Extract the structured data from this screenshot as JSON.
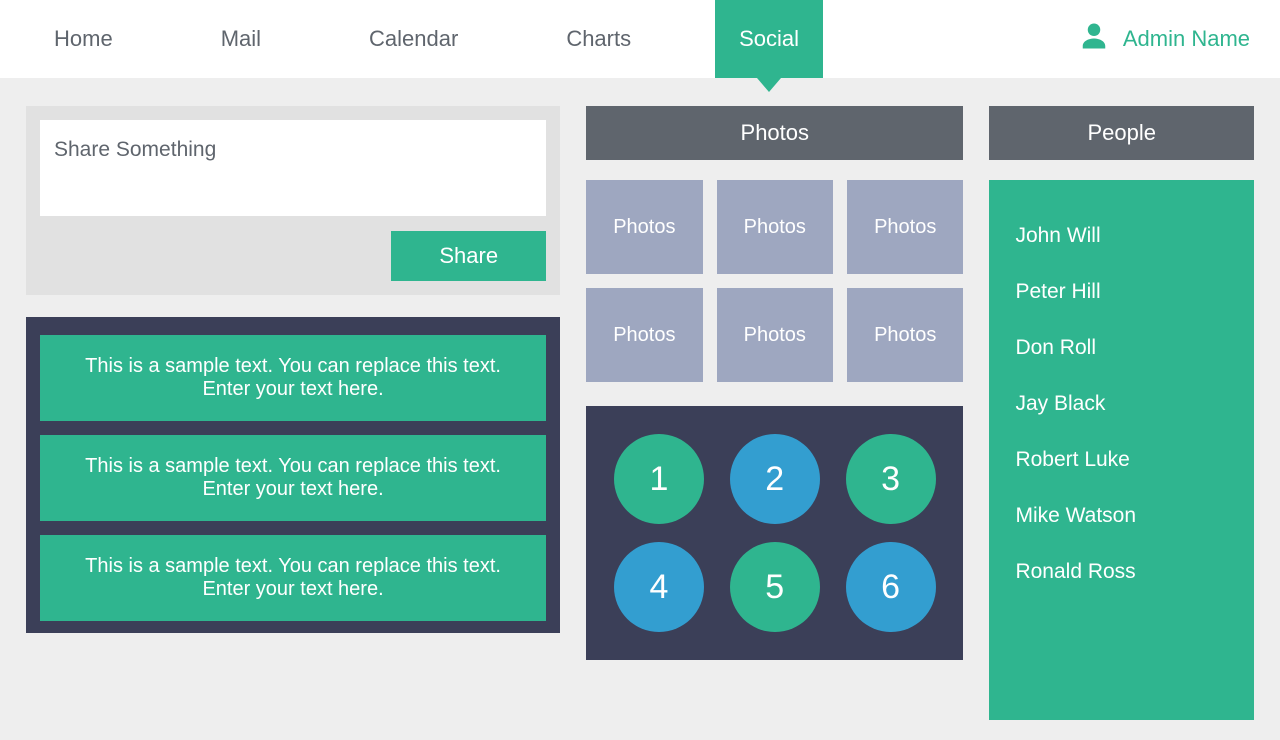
{
  "nav": {
    "tabs": [
      {
        "label": "Home"
      },
      {
        "label": "Mail"
      },
      {
        "label": "Calendar"
      },
      {
        "label": "Charts"
      },
      {
        "label": "Social",
        "active": true
      }
    ],
    "user_label": "Admin Name"
  },
  "share": {
    "placeholder": "Share Something",
    "button": "Share"
  },
  "feed": [
    "This is a sample text. You can replace this text. Enter your text here.",
    "This is a sample text. You can replace this text. Enter your text here.",
    "This is a sample text. You can replace this text. Enter your text here."
  ],
  "photos": {
    "header": "Photos",
    "tiles": [
      "Photos",
      "Photos",
      "Photos",
      "Photos",
      "Photos",
      "Photos"
    ]
  },
  "pad": [
    {
      "n": "1",
      "color": "green"
    },
    {
      "n": "2",
      "color": "blue"
    },
    {
      "n": "3",
      "color": "green"
    },
    {
      "n": "4",
      "color": "blue"
    },
    {
      "n": "5",
      "color": "green"
    },
    {
      "n": "6",
      "color": "blue"
    }
  ],
  "people": {
    "header": "People",
    "list": [
      "John Will",
      "Peter Hill",
      "Don Roll",
      "Jay Black",
      "Robert Luke",
      "Mike Watson",
      "Ronald Ross"
    ]
  }
}
